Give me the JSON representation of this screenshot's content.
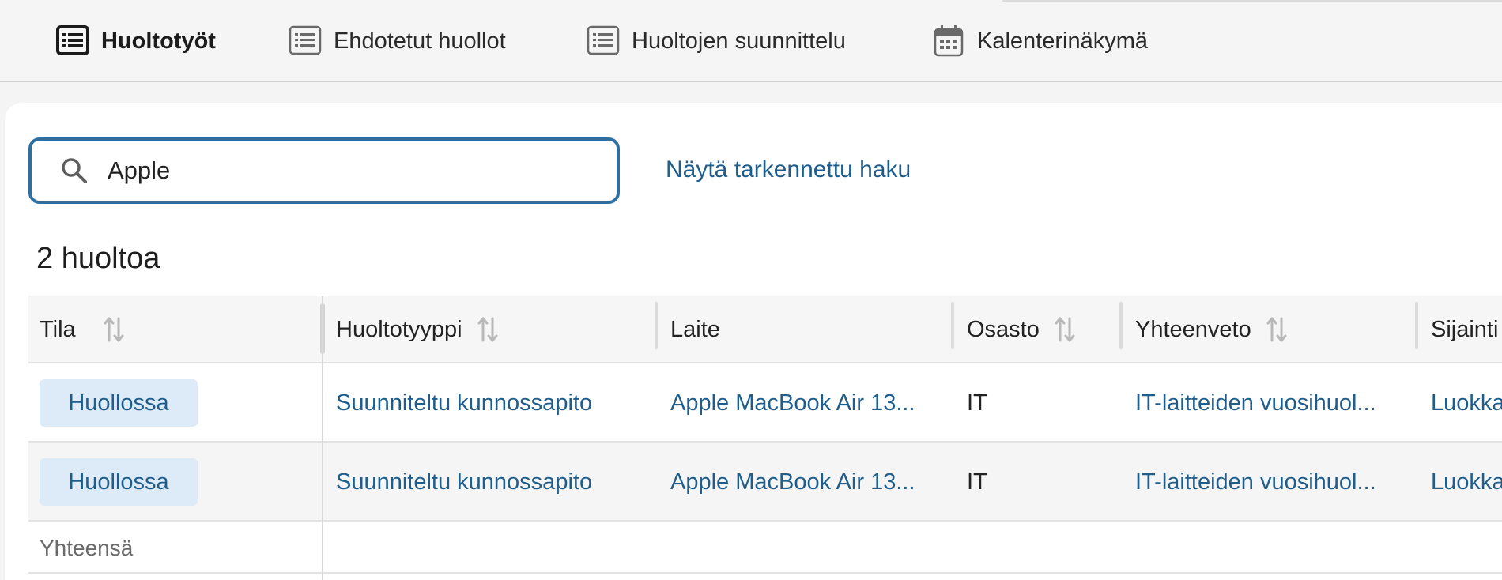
{
  "tabs": [
    {
      "label": "Huoltotyöt",
      "icon": "list-icon",
      "active": true
    },
    {
      "label": "Ehdotetut huollot",
      "icon": "list-icon",
      "active": false
    },
    {
      "label": "Huoltojen suunnittelu",
      "icon": "list-icon",
      "active": false
    },
    {
      "label": "Kalenterinäkymä",
      "icon": "calendar-icon",
      "active": false
    }
  ],
  "search": {
    "value": "Apple",
    "placeholder": ""
  },
  "advanced_search_label": "Näytä tarkennettu haku",
  "result_count": "2 huoltoa",
  "table": {
    "columns": [
      {
        "label": "Tila",
        "sortable": true
      },
      {
        "label": "Huoltotyyppi",
        "sortable": true
      },
      {
        "label": "Laite",
        "sortable": false
      },
      {
        "label": "Osasto",
        "sortable": true
      },
      {
        "label": "Yhteenveto",
        "sortable": true
      },
      {
        "label": "Sijainti",
        "sortable": false
      }
    ],
    "rows": [
      {
        "status": "Huollossa",
        "type": "Suunniteltu kunnossapito",
        "device": "Apple MacBook Air 13...",
        "department": "IT",
        "summary": "IT-laitteiden vuosihuol...",
        "location": "Luokka"
      },
      {
        "status": "Huollossa",
        "type": "Suunniteltu kunnossapito",
        "device": "Apple MacBook Air 13...",
        "department": "IT",
        "summary": "IT-laitteiden vuosihuol...",
        "location": "Luokka"
      }
    ],
    "footer_label": "Yhteensä"
  },
  "colors": {
    "accent": "#2e6fa0",
    "link": "#1f5e8c",
    "badge_bg": "#dcebf7"
  }
}
